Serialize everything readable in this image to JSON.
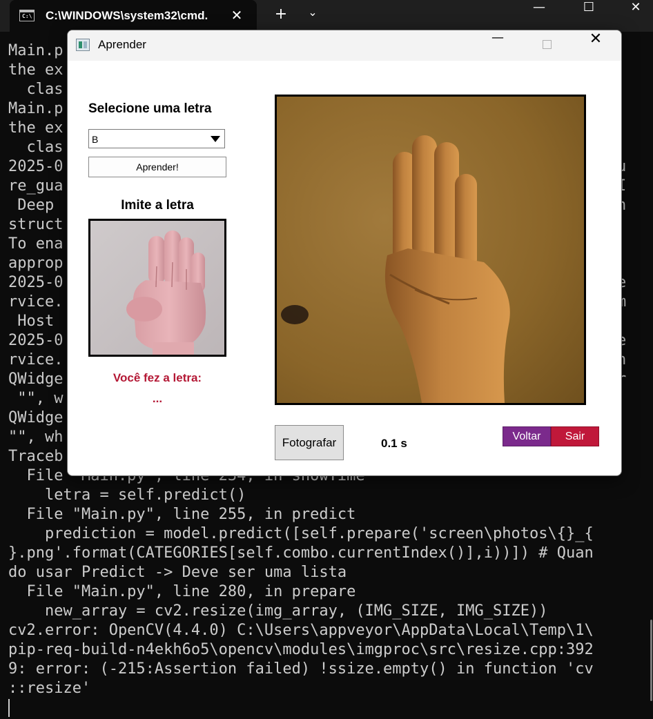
{
  "terminal": {
    "tab_title": "C:\\WINDOWS\\system32\\cmd.",
    "lines": [
      "Main.p",
      "the ex",
      "  clas",
      "Main.p",
      "the ex",
      "  clas",
      "2025-0",
      "re_gua",
      " Deep ",
      "struct",
      "To ena",
      "approp",
      "2025-0",
      "rvice.",
      " Host ",
      "2025-0",
      "rvice.",
      "QWidge",
      " \"\", w",
      "QWidge",
      "\"\", wh",
      "Traceb",
      "  File \"Main.py\", line 234, in showTime",
      "    letra = self.predict()",
      "  File \"Main.py\", line 255, in predict",
      "    prediction = model.predict([self.prepare('screen\\photos\\{}_{",
      "}.png'.format(CATEGORIES[self.combo.currentIndex()],i))]) # Quan",
      "do usar Predict -> Deve ser uma lista",
      "  File \"Main.py\", line 280, in prepare",
      "    new_array = cv2.resize(img_array, (IMG_SIZE, IMG_SIZE))",
      "cv2.error: OpenCV(4.4.0) C:\\Users\\appveyor\\AppData\\Local\\Temp\\1\\",
      "pip-req-build-n4ekh6o5\\opencv\\modules\\imgproc\\src\\resize.cpp:392",
      "9: error: (-215:Assertion failed) !ssize.empty() in function 'cv",
      "::resize'"
    ],
    "right_fragments": [
      {
        "line": 6,
        "text": "u"
      },
      {
        "line": 7,
        "text": "I"
      },
      {
        "line": 8,
        "text": "n"
      },
      {
        "line": 12,
        "text": "e"
      },
      {
        "line": 13,
        "text": "m"
      },
      {
        "line": 15,
        "text": "e"
      },
      {
        "line": 16,
        "text": "n"
      },
      {
        "line": 17,
        "text": "r"
      }
    ],
    "colors": {
      "background": "#0c0c0c",
      "text": "#cccccc",
      "titlebar": "#1f1f1f"
    },
    "icons": [
      "terminal-icon",
      "close-icon",
      "plus-icon",
      "chevron-down-icon",
      "minimize-icon",
      "maximize-icon",
      "close-icon"
    ]
  },
  "dialog": {
    "title": "Aprender",
    "select_label": "Selecione uma letra",
    "selected_letter": "B",
    "learn_button": "Aprender!",
    "imitate_label": "Imite a letra",
    "result_label": "Você fez a letra:",
    "result_value": "...",
    "photo_button": "Fotografar",
    "timer": "0.1 s",
    "back_button": "Voltar",
    "exit_button": "Sair",
    "colors": {
      "result_text": "#b41835",
      "back_button": "#7b2a8c",
      "exit_button": "#c0183a"
    }
  }
}
